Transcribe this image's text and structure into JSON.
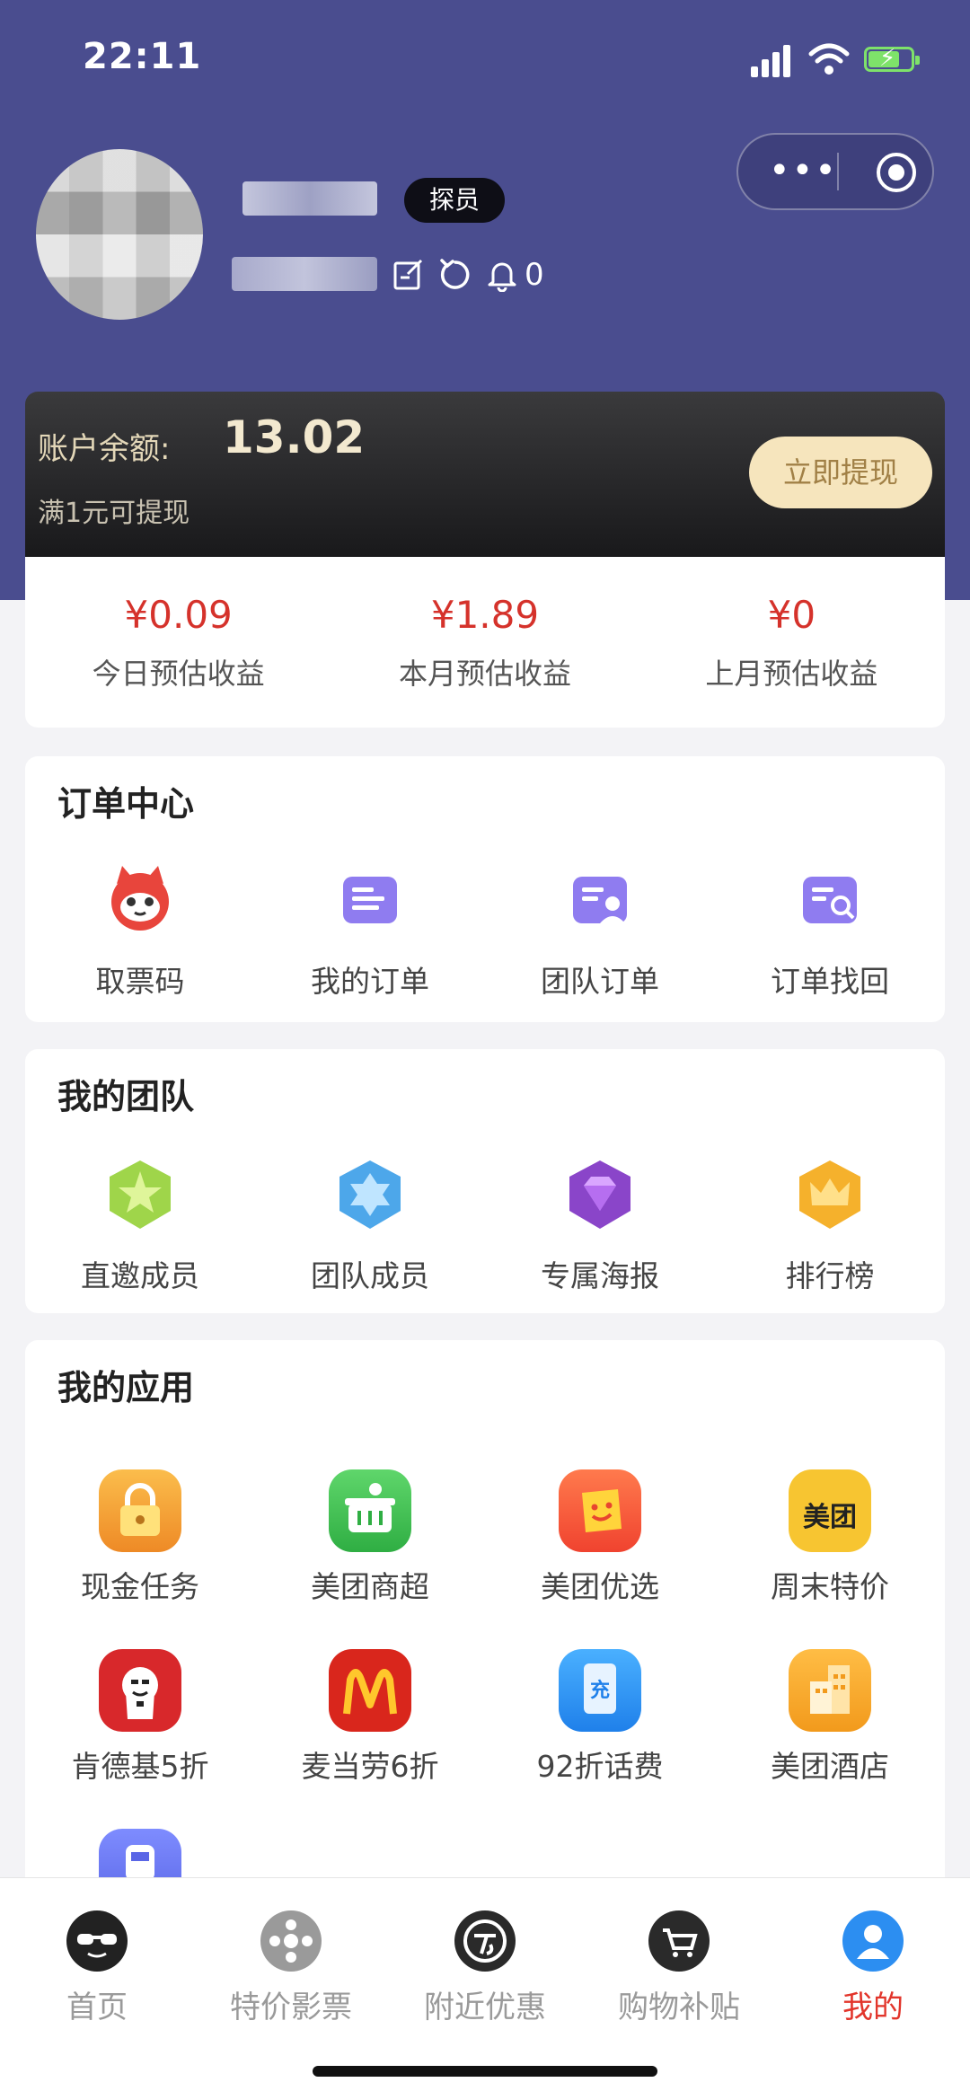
{
  "status_bar": {
    "time": "22:11"
  },
  "profile": {
    "role_badge": "探员",
    "notification_count": "0"
  },
  "balance": {
    "label": "账户余额:",
    "value": "13.02",
    "note": "满1元可提现",
    "withdraw_button": "立即提现"
  },
  "earnings": [
    {
      "value": "¥0.09",
      "label": "今日预估收益"
    },
    {
      "value": "¥1.89",
      "label": "本月预估收益"
    },
    {
      "value": "¥0",
      "label": "上月预估收益"
    }
  ],
  "order_center": {
    "title": "订单中心",
    "items": [
      {
        "label": "取票码",
        "icon": "cat-ticket-icon"
      },
      {
        "label": "我的订单",
        "icon": "order-list-icon"
      },
      {
        "label": "团队订单",
        "icon": "team-order-icon"
      },
      {
        "label": "订单找回",
        "icon": "order-search-icon"
      }
    ]
  },
  "my_team": {
    "title": "我的团队",
    "items": [
      {
        "label": "直邀成员",
        "icon": "green-star-badge-icon"
      },
      {
        "label": "团队成员",
        "icon": "blue-star-badge-icon"
      },
      {
        "label": "专属海报",
        "icon": "purple-diamond-badge-icon"
      },
      {
        "label": "排行榜",
        "icon": "crown-badge-icon"
      }
    ]
  },
  "my_apps": {
    "title": "我的应用",
    "items": [
      {
        "label": "现金任务",
        "icon": "lock-icon",
        "color": "#f2a235"
      },
      {
        "label": "美团商超",
        "icon": "basket-icon",
        "color": "#3fbf4f"
      },
      {
        "label": "美团优选",
        "icon": "smile-bag-icon",
        "color": "#f4553b"
      },
      {
        "label": "周末特价",
        "icon": "meituan-logo-icon",
        "color": "#f6c32f",
        "logo_text": "美团"
      },
      {
        "label": "肯德基5折",
        "icon": "kfc-icon",
        "color": "#d8282b"
      },
      {
        "label": "麦当劳6折",
        "icon": "mcdonalds-icon",
        "color": "#d9261c"
      },
      {
        "label": "92折话费",
        "icon": "phone-recharge-icon",
        "color": "#2d8ef0",
        "logo_text": "充"
      },
      {
        "label": "美团酒店",
        "icon": "hotel-icon",
        "color": "#f4a523"
      }
    ]
  },
  "tabbar": [
    {
      "label": "首页",
      "icon": "sunglasses-face-icon"
    },
    {
      "label": "特价影票",
      "icon": "film-reel-icon"
    },
    {
      "label": "附近优惠",
      "icon": "discount-circle-icon"
    },
    {
      "label": "购物补贴",
      "icon": "shopping-cart-icon"
    },
    {
      "label": "我的",
      "icon": "user-profile-icon",
      "active": true
    }
  ]
}
